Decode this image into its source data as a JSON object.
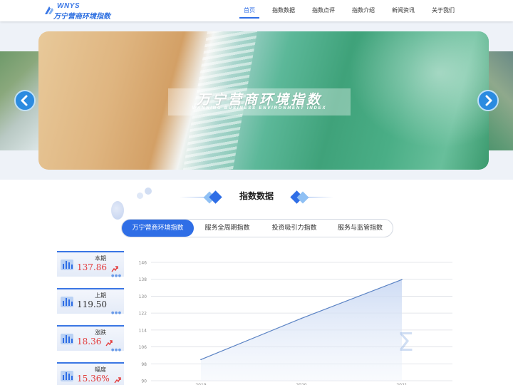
{
  "brand": {
    "en": "WNYS",
    "cn": "万宁营商环境指数"
  },
  "nav": [
    {
      "label": "首页",
      "active": true
    },
    {
      "label": "指数数据",
      "active": false
    },
    {
      "label": "指数点评",
      "active": false
    },
    {
      "label": "指数介绍",
      "active": false
    },
    {
      "label": "新闻资讯",
      "active": false
    },
    {
      "label": "关于我们",
      "active": false
    }
  ],
  "banner": {
    "title": "万宁营商环境指数",
    "subtitle": "WANNING BUSINESS ENVIRONMENT INDEX"
  },
  "section": {
    "title": "指数数据"
  },
  "tabs": [
    {
      "label": "万宁营商环境指数",
      "active": true
    },
    {
      "label": "服务全周期指数",
      "active": false
    },
    {
      "label": "投资吸引力指数",
      "active": false
    },
    {
      "label": "服务与监管指数",
      "active": false
    }
  ],
  "stats": [
    {
      "label": "本期",
      "value": "137.86",
      "highlight": true,
      "trend": "up"
    },
    {
      "label": "上期",
      "value": "119.50",
      "highlight": false,
      "trend": ""
    },
    {
      "label": "涨跌",
      "value": "18.36",
      "highlight": true,
      "trend": "up"
    },
    {
      "label": "幅度",
      "value": "15.36%",
      "highlight": true,
      "trend": "up"
    }
  ],
  "colors": {
    "accent": "#2f6ee6",
    "up": "#e33c3c",
    "line": "#5b83c4"
  },
  "chart_data": {
    "type": "area",
    "x": [
      "2019",
      "2020",
      "2021"
    ],
    "values": [
      100,
      119.5,
      137.86
    ],
    "yticks": [
      90,
      98,
      106,
      114,
      122,
      130,
      138,
      146
    ],
    "ylim": [
      90,
      146
    ],
    "grid": true
  }
}
